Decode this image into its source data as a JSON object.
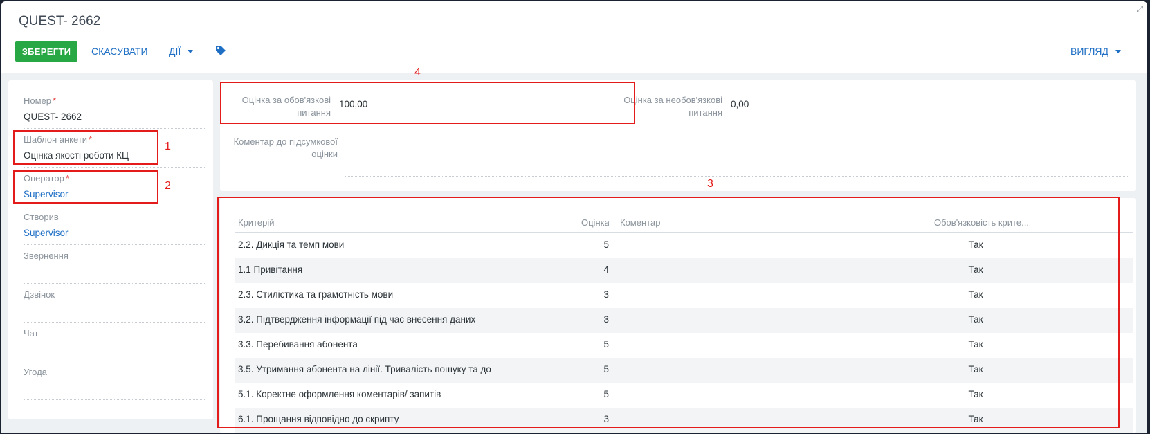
{
  "header": {
    "title": "QUEST- 2662",
    "save_label": "ЗБЕРЕГТИ",
    "cancel_label": "СКАСУВАТИ",
    "actions_label": "ДІЇ",
    "view_label": "ВИГЛЯД"
  },
  "left": {
    "number_label": "Номер",
    "number_value": "QUEST- 2662",
    "template_label": "Шаблон анкети",
    "template_value": "Оцінка якості роботи КЦ",
    "operator_label": "Оператор",
    "operator_value": "Supervisor",
    "created_label": "Створив",
    "created_value": "Supervisor",
    "request_label": "Звернення",
    "call_label": "Дзвінок",
    "chat_label": "Чат",
    "deal_label": "Угода"
  },
  "scores": {
    "mandatory_label": "Оцінка за обов'язкові питання",
    "mandatory_value": "100,00",
    "optional_label": "Оцінка за необов'язкові питання",
    "optional_value": "0,00",
    "comment_label": "Коментар до підсумкової оцінки"
  },
  "grid": {
    "headers": [
      "Критерій",
      "Оцінка",
      "Коментар",
      "Обов'язковість крите..."
    ],
    "rows": [
      {
        "criterion": "2.2. Дикція та темп мови",
        "score": "5",
        "comment": "",
        "required": "Так"
      },
      {
        "criterion": "1.1 Привітання",
        "score": "4",
        "comment": "",
        "required": "Так"
      },
      {
        "criterion": "2.3. Стилістика та грамотність мови",
        "score": "3",
        "comment": "",
        "required": "Так"
      },
      {
        "criterion": "3.2. Підтвердження інформації під час внесення даних",
        "score": "3",
        "comment": "",
        "required": "Так"
      },
      {
        "criterion": "3.3. Перебивання абонента",
        "score": "5",
        "comment": "",
        "required": "Так"
      },
      {
        "criterion": "3.5. Утримання абонента на лінії. Тривалість пошуку та до",
        "score": "5",
        "comment": "",
        "required": "Так"
      },
      {
        "criterion": "5.1. Коректне оформлення коментарів/ запитів",
        "score": "5",
        "comment": "",
        "required": "Так"
      },
      {
        "criterion": "6.1. Прощання відповідно до скрипту",
        "score": "3",
        "comment": "",
        "required": "Так"
      }
    ]
  },
  "annotations": [
    "1",
    "2",
    "3",
    "4"
  ],
  "colors": {
    "accent": "#1f6fc5",
    "save": "#28a745",
    "annotation": "#e31b1b"
  }
}
